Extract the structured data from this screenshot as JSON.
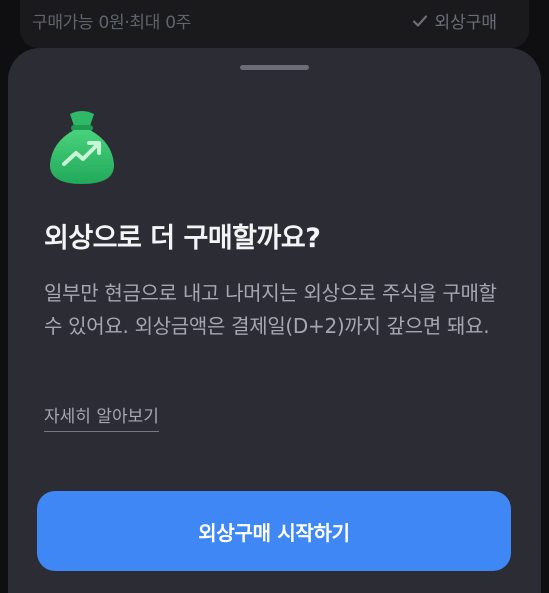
{
  "top_bar": {
    "available_text": "구매가능 0원·최대 0주",
    "margin_buy_label": "외상구매",
    "check_icon": "check-icon"
  },
  "sheet": {
    "icon": "money-bag-icon",
    "title": "외상으로 더 구매할까요?",
    "description": "일부만 현금으로 내고 나머지는 외상으로 주식을 구매할 수 있어요. 외상금액은 결제일(D+2)까지 갚으면 돼요.",
    "learn_more": "자세히 알아보기",
    "primary_button": "외상구매 시작하기"
  },
  "colors": {
    "sheet_bg": "#2c2c35",
    "accent": "#3f87f5",
    "icon_green": "#35c06a"
  }
}
